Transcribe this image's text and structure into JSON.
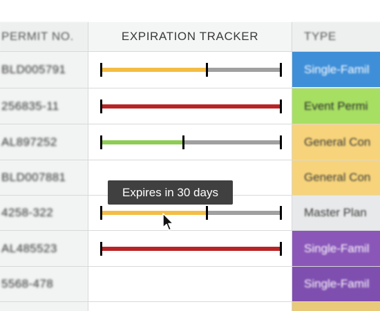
{
  "headers": {
    "permit_no": "PERMIT NO.",
    "expiration_tracker": "EXPIRATION TRACKER",
    "type": "TYPE"
  },
  "rows": [
    {
      "permit_no": "BLD005791",
      "type": "Single-Famil",
      "type_color": "#3f8fd8",
      "type_text_color": "#ffffff",
      "status_color": "#f3bd45",
      "fraction_remaining": 0.59
    },
    {
      "permit_no": "256835-11",
      "type": "Event Permi",
      "type_color": "#a7df63",
      "type_text_color": "#2a2a2a",
      "status_color": "#b82426",
      "fraction_remaining": 1.0
    },
    {
      "permit_no": "AL897252",
      "type": "General Con",
      "type_color": "#f7d47b",
      "type_text_color": "#3a3a3a",
      "status_color": "#8fcc53",
      "fraction_remaining": 0.46
    },
    {
      "permit_no": "BLD007881",
      "type": "General Con",
      "type_color": "#f7d47b",
      "type_text_color": "#3a3a3a",
      "status_color": null,
      "fraction_remaining": null
    },
    {
      "permit_no": "4258-322",
      "type": "Master Plan",
      "type_color": "#e8e9ea",
      "type_text_color": "#3a3a3a",
      "status_color": "#f3bd45",
      "fraction_remaining": 0.59
    },
    {
      "permit_no": "AL485523",
      "type": "Single-Famil",
      "type_color": "#8a57b9",
      "type_text_color": "#ffffff",
      "status_color": "#b82426",
      "fraction_remaining": 1.0
    },
    {
      "permit_no": "5568-478",
      "type": "Single-Famil",
      "type_color": "#7f4fb0",
      "type_text_color": "#ffffff",
      "status_color": null,
      "fraction_remaining": null
    }
  ],
  "tooltip": {
    "text": "Expires in 30 days"
  },
  "colors": {
    "track_gray": "#a0a0a0",
    "partial_bottom": "#e9c97a"
  }
}
